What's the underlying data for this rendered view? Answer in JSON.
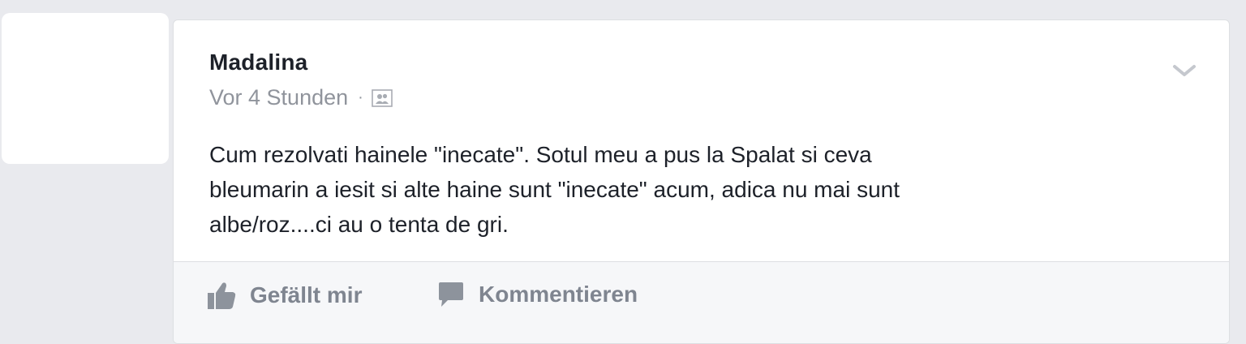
{
  "post": {
    "author": "Madalina",
    "timestamp": "Vor 4 Stunden",
    "separator": "·",
    "audience_icon": "friends-icon",
    "menu_icon": "chevron-down-icon",
    "text": "Cum rezolvati hainele \"inecate\". Sotul meu a pus la Spalat si ceva\nbleumarin a iesit si alte haine sunt \"inecate\" acum, adica nu mai sunt\nalbe/roz....ci au o tenta de gri."
  },
  "actions": {
    "like_label": "Gefällt mir",
    "like_icon": "thumbs-up-icon",
    "comment_label": "Kommentieren",
    "comment_icon": "comment-bubble-icon"
  },
  "colors": {
    "background": "#e9eaee",
    "card": "#ffffff",
    "text_primary": "#1d2129",
    "text_secondary": "#90949c",
    "action_text": "#7f8590"
  }
}
